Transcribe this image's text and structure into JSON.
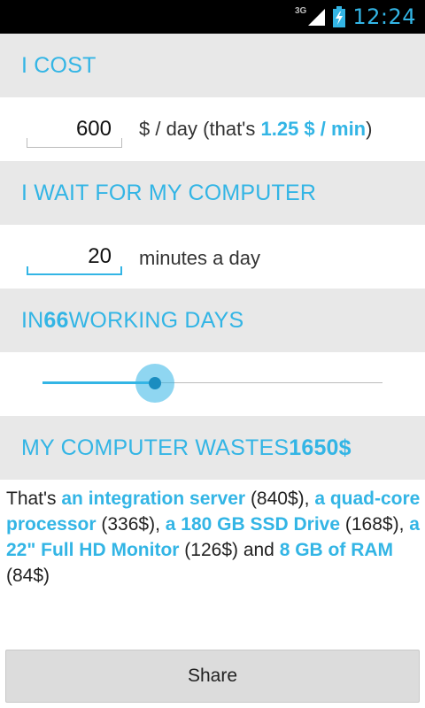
{
  "statusbar": {
    "network": "3G",
    "time": "12:24",
    "signal_icon": "signal-icon",
    "battery_icon": "battery-charging-icon"
  },
  "colors": {
    "accent": "#33b5e5",
    "section_bg": "#e8e8e8"
  },
  "cost": {
    "header": "I COST",
    "value": "600",
    "suffix_prefix": "$ / day (that's ",
    "suffix_accent": "1.25 $ / min",
    "suffix_end": ")"
  },
  "wait": {
    "header": "I WAIT FOR MY COMPUTER",
    "value": "20",
    "suffix": "minutes a day"
  },
  "days": {
    "header_prefix": "IN ",
    "count": "66",
    "header_suffix": " WORKING DAYS",
    "slider_fraction": 0.33
  },
  "waste": {
    "header_prefix": "MY COMPUTER WASTES ",
    "amount": "1650$"
  },
  "summary": {
    "intro": "That's ",
    "item1": "an integration server",
    "price1": " (840$), ",
    "item2": "a quad-core processor",
    "price2": " (336$), ",
    "item3": "a 180 GB SSD Drive",
    "price3": " (168$), ",
    "item4": "a 22\" Full HD Monitor",
    "price4": " (126$) and ",
    "item5": "8 GB of RAM",
    "price5": " (84$)"
  },
  "share": {
    "label": "Share"
  }
}
